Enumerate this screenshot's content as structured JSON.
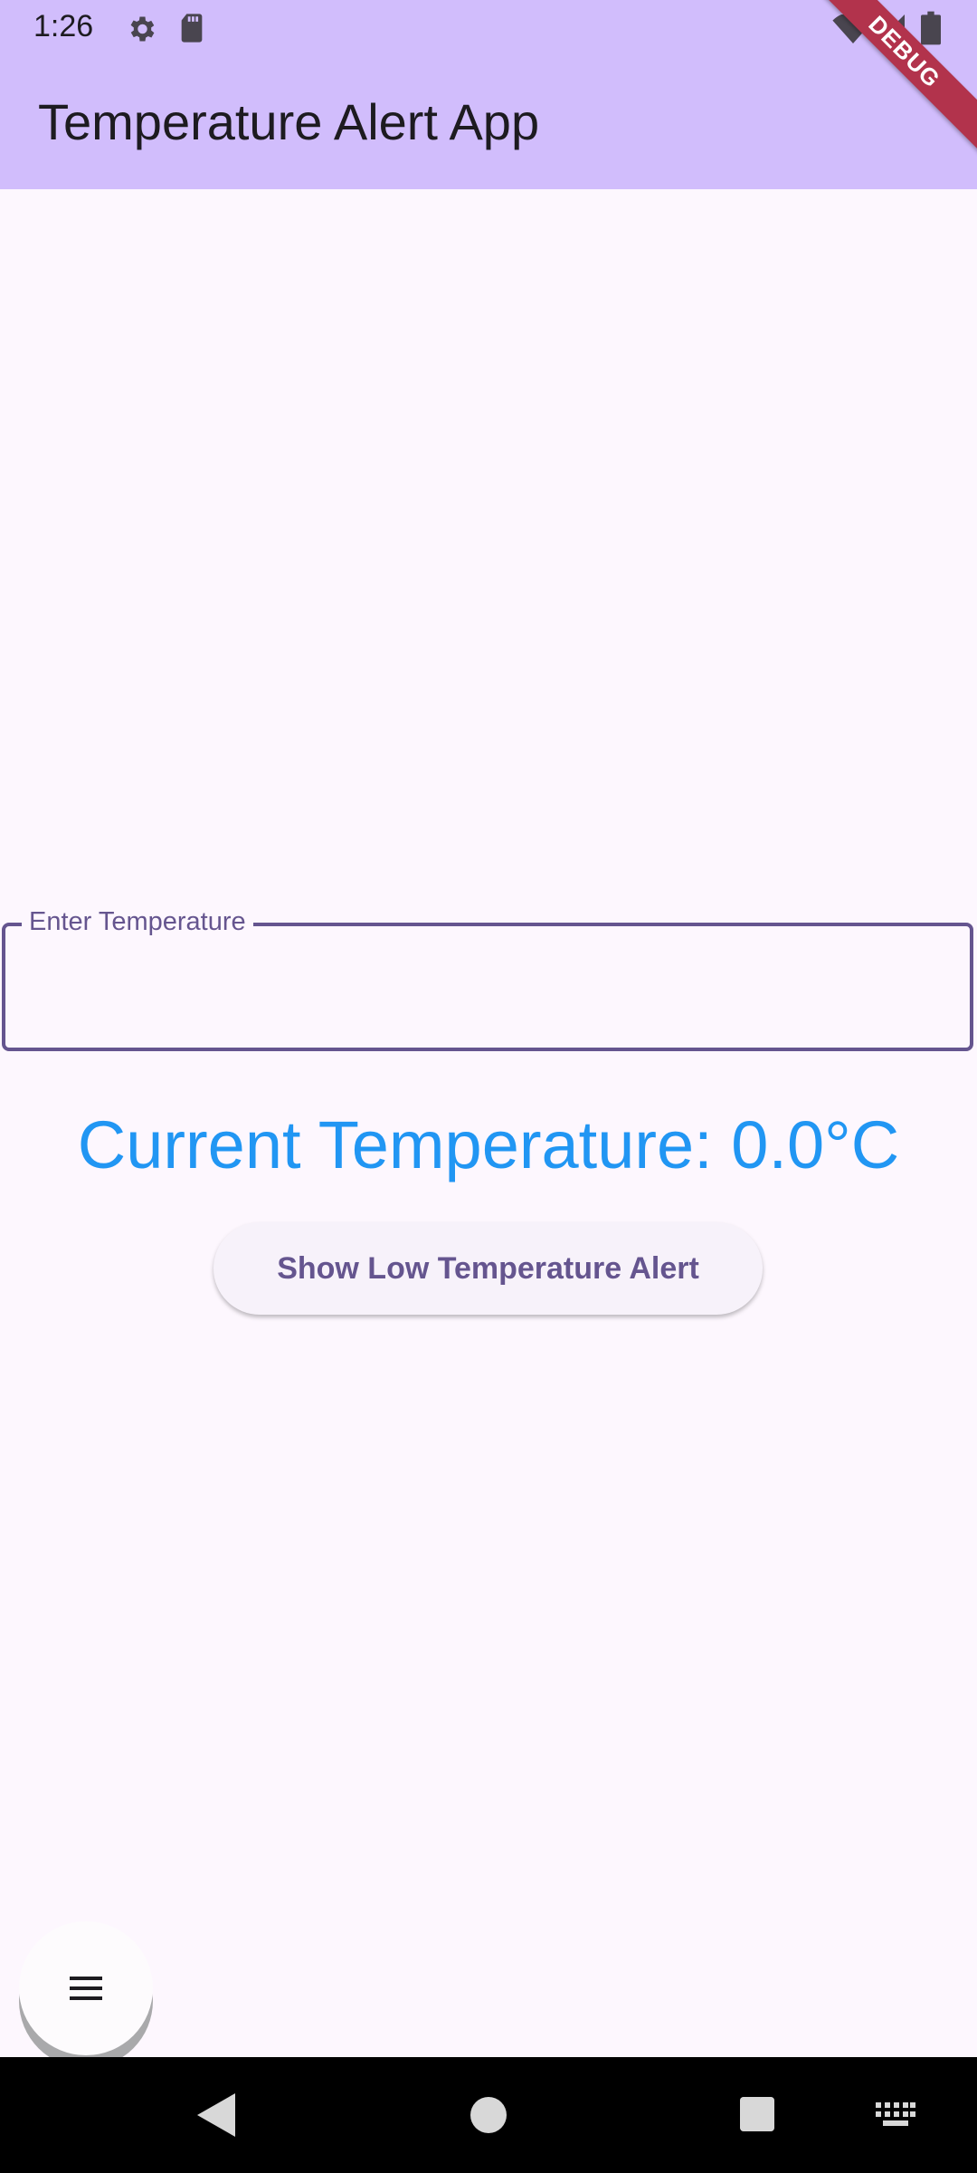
{
  "status_bar": {
    "time": "1:26",
    "icons": [
      "settings-icon",
      "sd-card-icon",
      "wifi-icon",
      "signal-icon",
      "battery-icon"
    ]
  },
  "app_bar": {
    "title": "Temperature Alert App",
    "debug_banner": "DEBUG"
  },
  "temperature_field": {
    "label": "Enter Temperature",
    "value": ""
  },
  "current_temperature_text": "Current Temperature: 0.0°C",
  "alert_button_label": "Show Low Temperature Alert",
  "fab": {
    "icon": "menu-icon"
  },
  "nav_bar": {
    "icons": [
      "back-icon",
      "home-icon",
      "recents-icon",
      "keyboard-icon"
    ]
  },
  "colors": {
    "app_bar": "#d1bdfc",
    "background": "#fdf7fe",
    "accent": "#65558f",
    "temperature_text": "#2196f3",
    "debug_banner": "#b2334c"
  }
}
